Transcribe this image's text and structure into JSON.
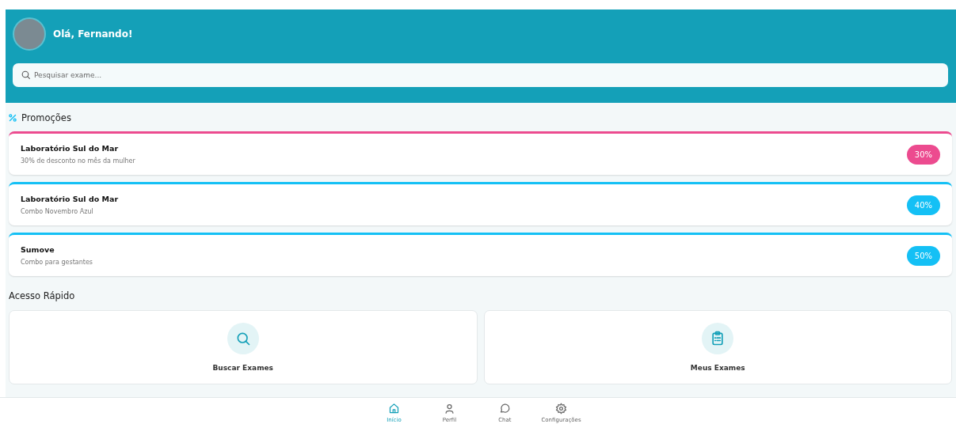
{
  "header": {
    "greeting": "Olá, Fernando!",
    "search": {
      "placeholder": "Pesquisar exame..."
    }
  },
  "promotions": {
    "title": "Promoções",
    "items": [
      {
        "name": "Laboratório Sul do Mar",
        "description": "30% de desconto no mês da mulher",
        "discount": "30%",
        "color": "#ec4b8f"
      },
      {
        "name": "Laboratório Sul do Mar",
        "description": "Combo Novembro Azul",
        "discount": "40%",
        "color": "#14c0f5"
      },
      {
        "name": "Sumove",
        "description": "Combo para gestantes",
        "discount": "50%",
        "color": "#14c0f5"
      }
    ]
  },
  "quick_access": {
    "title": "Acesso Rápido",
    "items": [
      {
        "kind": "search",
        "label": "Buscar Exames"
      },
      {
        "kind": "clipboard",
        "label": "Meus Exames"
      }
    ]
  },
  "bottom_nav": [
    {
      "kind": "home",
      "label": "Início",
      "selected": true
    },
    {
      "kind": "person",
      "label": "Perfil",
      "selected": false
    },
    {
      "kind": "chat",
      "label": "Chat",
      "selected": false
    },
    {
      "kind": "gear",
      "label": "Configurações",
      "selected": false
    }
  ]
}
